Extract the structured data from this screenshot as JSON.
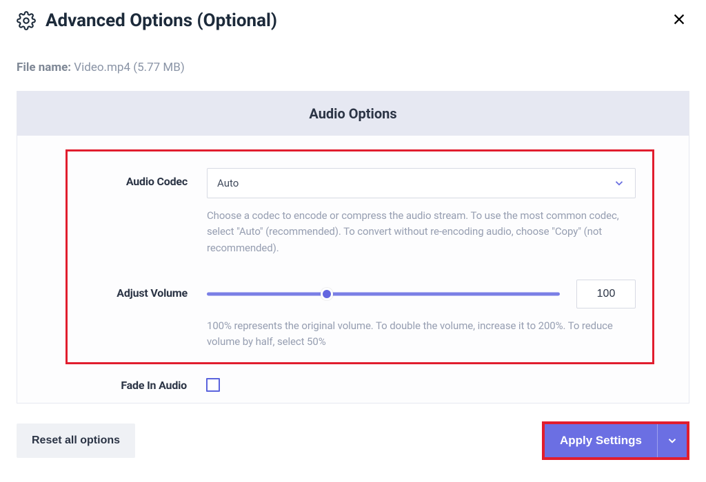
{
  "header": {
    "title": "Advanced Options (Optional)"
  },
  "file": {
    "label": "File name:",
    "name": "Video.mp4",
    "size": "(5.77 MB)"
  },
  "section": {
    "title": "Audio Options"
  },
  "codec": {
    "label": "Audio Codec",
    "value": "Auto",
    "help": "Choose a codec to encode or compress the audio stream. To use the most common codec, select \"Auto\" (recommended). To convert without re-encoding audio, choose \"Copy\" (not recommended)."
  },
  "volume": {
    "label": "Adjust Volume",
    "value": "100",
    "help": "100% represents the original volume. To double the volume, increase it to 200%. To reduce volume by half, select 50%"
  },
  "fade_in": {
    "label": "Fade In Audio",
    "checked": false
  },
  "footer": {
    "reset": "Reset all options",
    "apply": "Apply Settings"
  }
}
